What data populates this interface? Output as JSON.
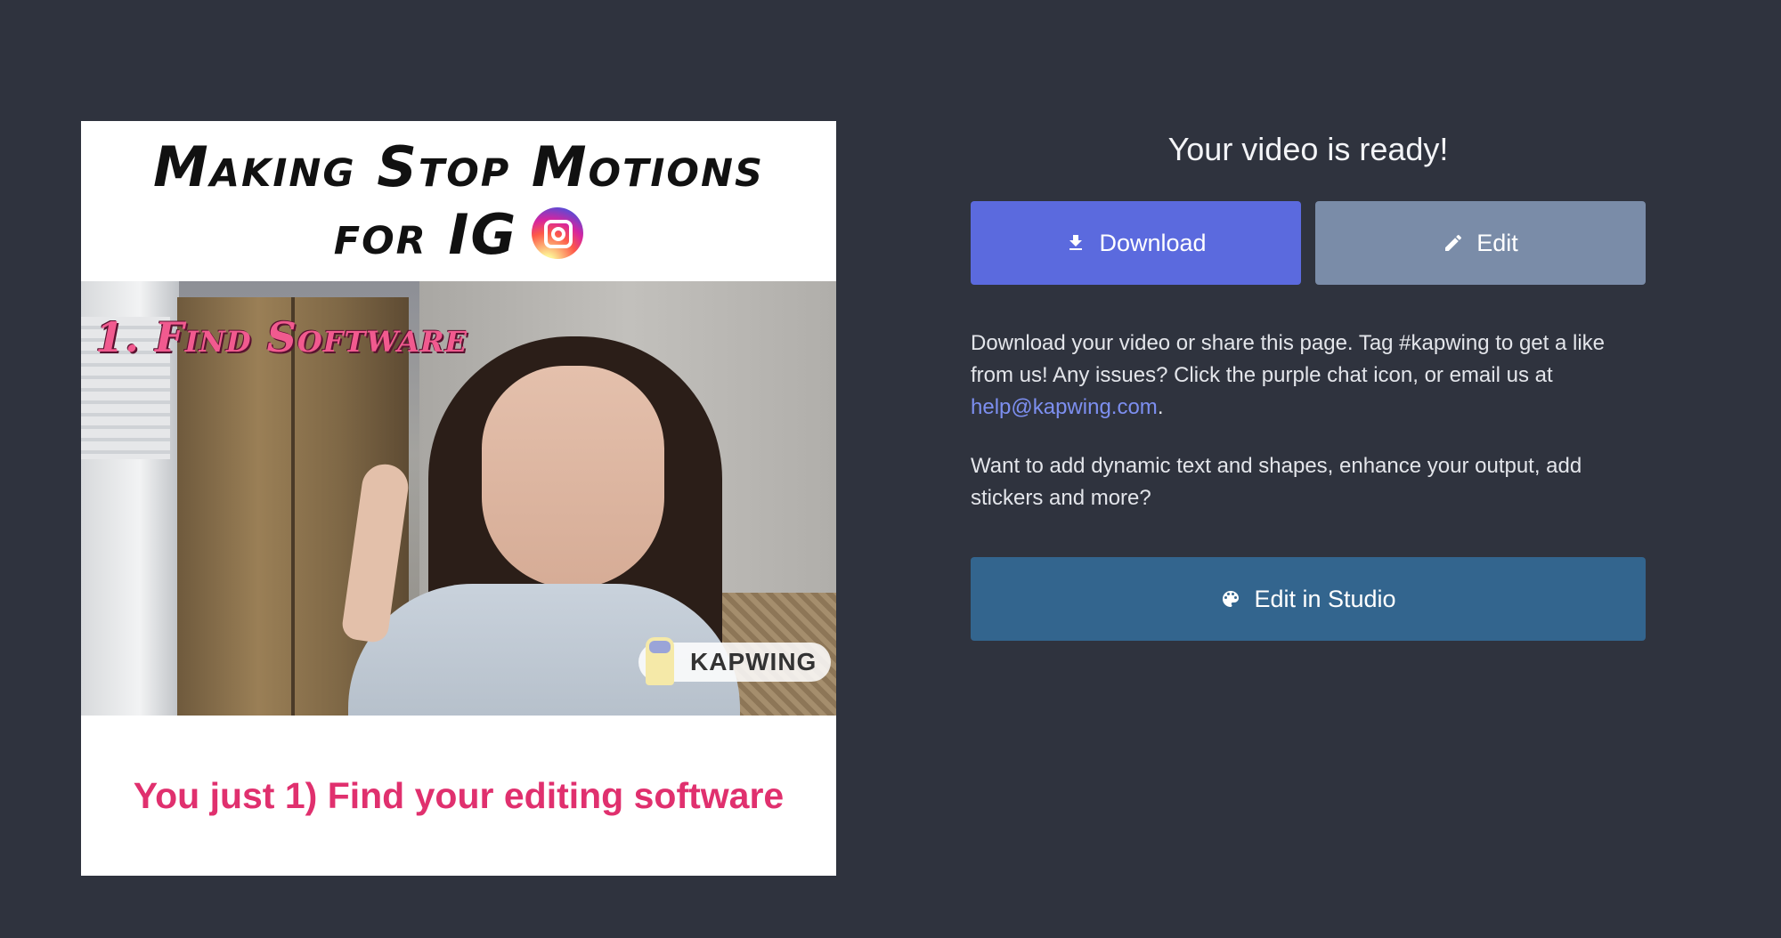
{
  "preview": {
    "title_line1": "Making Stop Motions",
    "title_line2": "for IG",
    "scene_caption": "1. Find Software",
    "watermark": "KAPWING",
    "subtitle": "You just 1) Find your editing software"
  },
  "panel": {
    "heading": "Your video is ready!",
    "download_label": "Download",
    "edit_label": "Edit",
    "description_prefix": "Download your video or share this page. Tag #kapwing to get a like from us! Any issues? Click the purple chat icon, or email us at ",
    "email": "help@kapwing.com",
    "description_suffix": ".",
    "studio_prompt": "Want to add dynamic text and shapes, enhance your output, add stickers and more?",
    "studio_label": "Edit in Studio"
  },
  "icons": {
    "download": "download-icon",
    "edit": "pencil-icon",
    "studio": "palette-icon",
    "instagram": "instagram-icon"
  },
  "colors": {
    "background": "#2f333e",
    "download_button": "#5b6ade",
    "edit_button": "#7a8ca8",
    "studio_button": "#33658e",
    "link": "#7d8ff0",
    "subtitle_text": "#e0306e"
  }
}
